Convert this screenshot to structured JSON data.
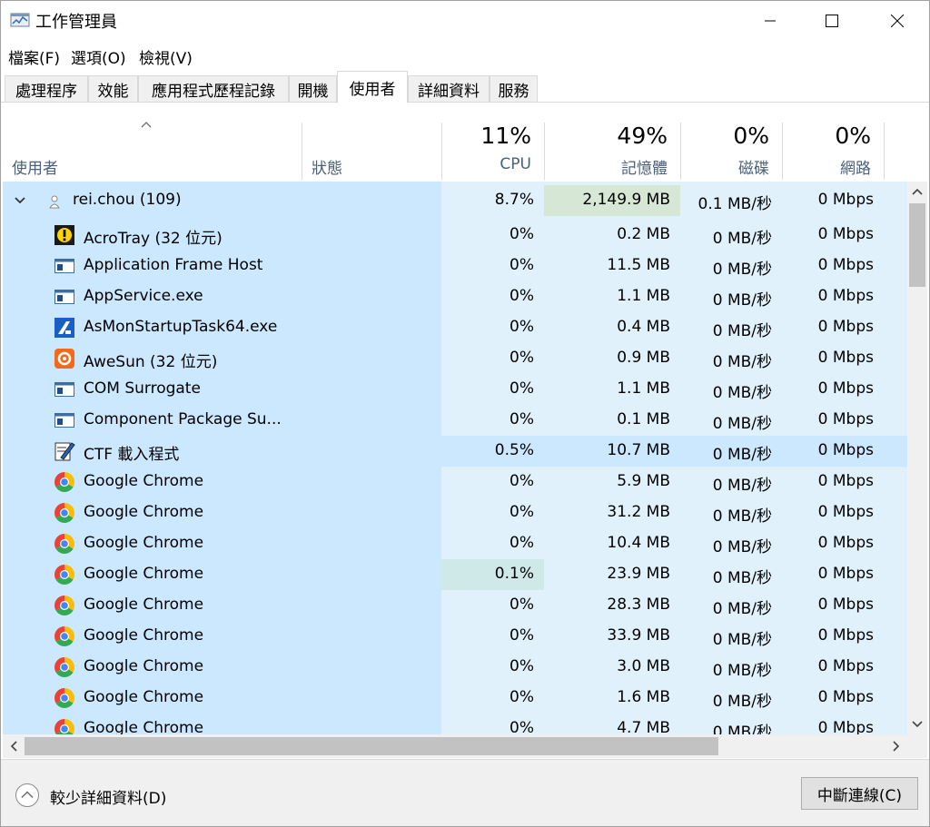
{
  "window": {
    "title": "工作管理員"
  },
  "menu": [
    "檔案(F)",
    "選項(O)",
    "檢視(V)"
  ],
  "tabs": [
    "處理程序",
    "效能",
    "應用程式歷程記錄",
    "開機",
    "使用者",
    "詳細資料",
    "服務"
  ],
  "active_tab": "使用者",
  "columns": {
    "user": "使用者",
    "status": "狀態",
    "cpu": {
      "pct": "11%",
      "label": "CPU"
    },
    "memory": {
      "pct": "49%",
      "label": "記憶體"
    },
    "disk": {
      "pct": "0%",
      "label": "磁碟"
    },
    "network": {
      "pct": "0%",
      "label": "網路"
    }
  },
  "user_row": {
    "name": "rei.chou (109)",
    "cpu": "8.7%",
    "memory": "2,149.9 MB",
    "disk": "0.1 MB/秒",
    "network": "0 Mbps"
  },
  "processes": [
    {
      "name": "AcroTray (32 位元)",
      "icon": "acrotray-icon",
      "cpu": "0%",
      "memory": "0.2 MB",
      "disk": "0 MB/秒",
      "network": "0 Mbps"
    },
    {
      "name": "Application Frame Host",
      "icon": "window-app-icon",
      "cpu": "0%",
      "memory": "11.5 MB",
      "disk": "0 MB/秒",
      "network": "0 Mbps"
    },
    {
      "name": "AppService.exe",
      "icon": "window-app-icon",
      "cpu": "0%",
      "memory": "1.1 MB",
      "disk": "0 MB/秒",
      "network": "0 Mbps"
    },
    {
      "name": "AsMonStartupTask64.exe",
      "icon": "asus-icon",
      "cpu": "0%",
      "memory": "0.4 MB",
      "disk": "0 MB/秒",
      "network": "0 Mbps"
    },
    {
      "name": "AweSun (32 位元)",
      "icon": "awesun-icon",
      "cpu": "0%",
      "memory": "0.9 MB",
      "disk": "0 MB/秒",
      "network": "0 Mbps"
    },
    {
      "name": "COM Surrogate",
      "icon": "window-app-icon",
      "cpu": "0%",
      "memory": "1.1 MB",
      "disk": "0 MB/秒",
      "network": "0 Mbps"
    },
    {
      "name": "Component Package Su...",
      "icon": "window-app-icon",
      "cpu": "0%",
      "memory": "0.1 MB",
      "disk": "0 MB/秒",
      "network": "0 Mbps"
    },
    {
      "name": "CTF 載入程式",
      "icon": "ctf-loader-icon",
      "cpu": "0.5%",
      "memory": "10.7 MB",
      "disk": "0 MB/秒",
      "network": "0 Mbps"
    },
    {
      "name": "Google Chrome",
      "icon": "chrome-icon",
      "cpu": "0%",
      "memory": "5.9 MB",
      "disk": "0 MB/秒",
      "network": "0 Mbps"
    },
    {
      "name": "Google Chrome",
      "icon": "chrome-icon",
      "cpu": "0%",
      "memory": "31.2 MB",
      "disk": "0 MB/秒",
      "network": "0 Mbps"
    },
    {
      "name": "Google Chrome",
      "icon": "chrome-icon",
      "cpu": "0%",
      "memory": "10.4 MB",
      "disk": "0 MB/秒",
      "network": "0 Mbps"
    },
    {
      "name": "Google Chrome",
      "icon": "chrome-icon",
      "cpu": "0.1%",
      "memory": "23.9 MB",
      "disk": "0 MB/秒",
      "network": "0 Mbps"
    },
    {
      "name": "Google Chrome",
      "icon": "chrome-icon",
      "cpu": "0%",
      "memory": "28.3 MB",
      "disk": "0 MB/秒",
      "network": "0 Mbps"
    },
    {
      "name": "Google Chrome",
      "icon": "chrome-icon",
      "cpu": "0%",
      "memory": "33.9 MB",
      "disk": "0 MB/秒",
      "network": "0 Mbps"
    },
    {
      "name": "Google Chrome",
      "icon": "chrome-icon",
      "cpu": "0%",
      "memory": "3.0 MB",
      "disk": "0 MB/秒",
      "network": "0 Mbps"
    },
    {
      "name": "Google Chrome",
      "icon": "chrome-icon",
      "cpu": "0%",
      "memory": "1.6 MB",
      "disk": "0 MB/秒",
      "network": "0 Mbps"
    },
    {
      "name": "Google Chrome",
      "icon": "chrome-icon",
      "cpu": "0%",
      "memory": "4.7 MB",
      "disk": "0 MB/秒",
      "network": "0 Mbps"
    }
  ],
  "footer": {
    "fewer_details": "較少詳細資料(D)",
    "disconnect": "中斷連線(C)"
  },
  "colors": {
    "selection": "#cce8ff",
    "cell_highlight": "#e0f1fb",
    "header_label": "#4c607a"
  }
}
